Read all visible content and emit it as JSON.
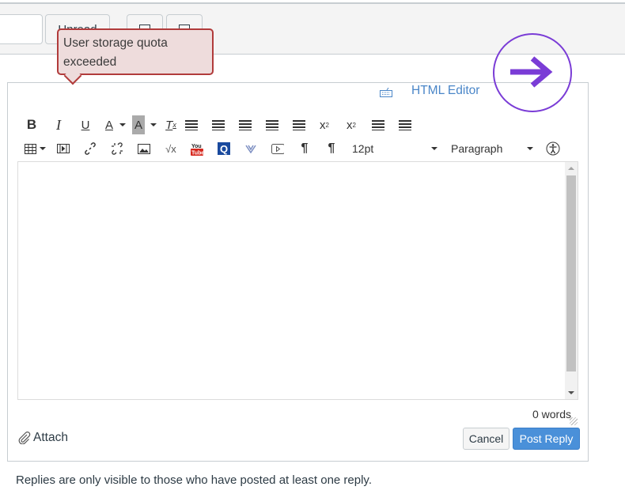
{
  "topbar": {
    "unread_label": "Unread",
    "icon_buttons": [
      "collapse-icon",
      "expand-icon"
    ]
  },
  "tooltip": {
    "text": "User storage quota exceeded"
  },
  "overlay": {
    "icon": "arrow-right-circle-icon",
    "color": "#7a3cd6"
  },
  "editor": {
    "html_editor_label": "HTML Editor",
    "toolbar_row1": [
      "bold",
      "italic",
      "underline",
      "text-color",
      "background-color",
      "clear-formatting",
      "align-left",
      "align-center",
      "align-right",
      "outdent",
      "indent",
      "superscript",
      "subscript",
      "bullet-list",
      "numbered-list"
    ],
    "toolbar_row2": [
      "table",
      "media",
      "link",
      "unlink",
      "image",
      "math",
      "youtube",
      "quizlet",
      "vimeo",
      "embed-media",
      "ltr",
      "rtl"
    ],
    "font_size": "12pt",
    "block_format": "Paragraph",
    "word_count": "0 words"
  },
  "actions": {
    "attach_label": "Attach",
    "cancel_label": "Cancel",
    "post_label": "Post Reply",
    "post_color": "#4a90d9"
  },
  "note": "Replies are only visible to those who have posted at least one reply."
}
